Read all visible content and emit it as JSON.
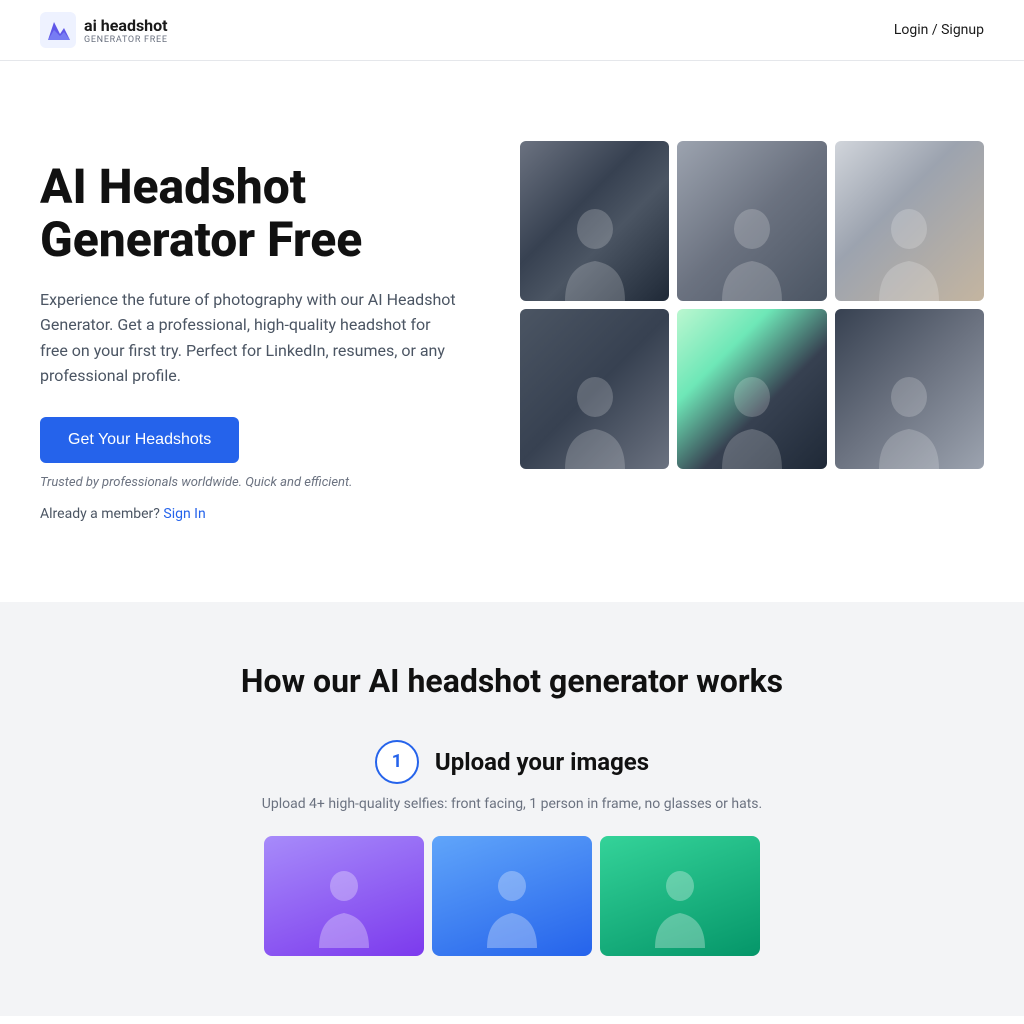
{
  "header": {
    "logo_main": "ai headshot",
    "logo_sub": "GENERATOR FREE",
    "nav_login": "Login / Signup"
  },
  "hero": {
    "title": "AI Headshot Generator Free",
    "description": "Experience the future of photography with our AI Headshot Generator. Get a professional, high-quality headshot for free on your first try. Perfect for LinkedIn, resumes, or any professional profile.",
    "cta_label": "Get Your Headshots",
    "trusted_text": "Trusted by professionals worldwide. Quick and efficient.",
    "already_member_text": "Already a member?",
    "sign_in_label": "Sign In"
  },
  "how_section": {
    "title": "How our AI headshot generator works",
    "step1": {
      "number": "1",
      "label": "Upload your images",
      "desc": "Upload 4+ high-quality selfies: front facing, 1 person in frame, no glasses or hats."
    }
  }
}
